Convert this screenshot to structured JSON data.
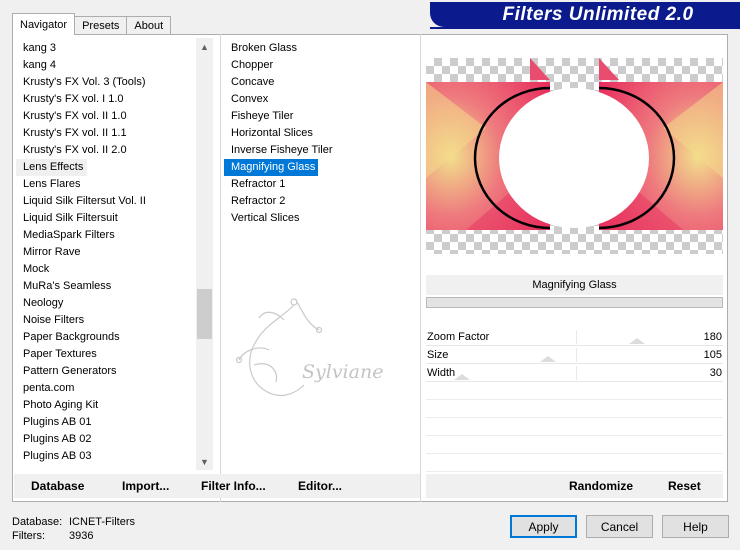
{
  "tabs": [
    {
      "label": "Navigator",
      "active": true
    },
    {
      "label": "Presets",
      "active": false
    },
    {
      "label": "About",
      "active": false
    }
  ],
  "banner": {
    "title": "Filters Unlimited 2.0"
  },
  "categories": {
    "items": [
      "kang 3",
      "kang 4",
      "Krusty's FX Vol. 3 (Tools)",
      "Krusty's FX vol. I 1.0",
      "Krusty's FX vol. II 1.0",
      "Krusty's FX vol. II 1.1",
      "Krusty's FX vol. II 2.0",
      "Lens Effects",
      "Lens Flares",
      "Liquid Silk Filtersut Vol. II",
      "Liquid Silk Filtersuit",
      "MediaSpark Filters",
      "Mirror Rave",
      "Mock",
      "MuRa's Seamless",
      "Neology",
      "Noise Filters",
      "Paper Backgrounds",
      "Paper Textures",
      "Pattern Generators",
      "penta.com",
      "Photo Aging Kit",
      "Plugins AB 01",
      "Plugins AB 02",
      "Plugins AB 03"
    ],
    "selected": "Lens Effects"
  },
  "filters": {
    "items": [
      "Broken Glass",
      "Chopper",
      "Concave",
      "Convex",
      "Fisheye Tiler",
      "Horizontal Slices",
      "Inverse Fisheye Tiler",
      "Magnifying Glass",
      "Refractor 1",
      "Refractor 2",
      "Vertical Slices"
    ],
    "selected": "Magnifying Glass"
  },
  "watermark": {
    "text": "Sylviane"
  },
  "params": {
    "title": "Magnifying Glass",
    "rows": [
      {
        "label": "Zoom Factor",
        "value": "180",
        "fraction": 0.71
      },
      {
        "label": "Size",
        "value": "105",
        "fraction": 0.41
      },
      {
        "label": "Width",
        "value": "30",
        "fraction": 0.12
      }
    ]
  },
  "left_buttons": {
    "database": "Database",
    "import": "Import...",
    "filter_info": "Filter Info...",
    "editor": "Editor..."
  },
  "right_buttons": {
    "randomize": "Randomize",
    "reset": "Reset"
  },
  "status": {
    "database_label": "Database:",
    "database_value": "ICNET-Filters",
    "filters_label": "Filters:",
    "filters_value": "3936"
  },
  "dialog_buttons": {
    "apply": "Apply",
    "cancel": "Cancel",
    "help": "Help"
  },
  "colors": {
    "banner": "#0b1a8c",
    "selection": "#0078d7",
    "preview_pink": "#e8426a",
    "preview_yellow": "#f2e08c"
  }
}
